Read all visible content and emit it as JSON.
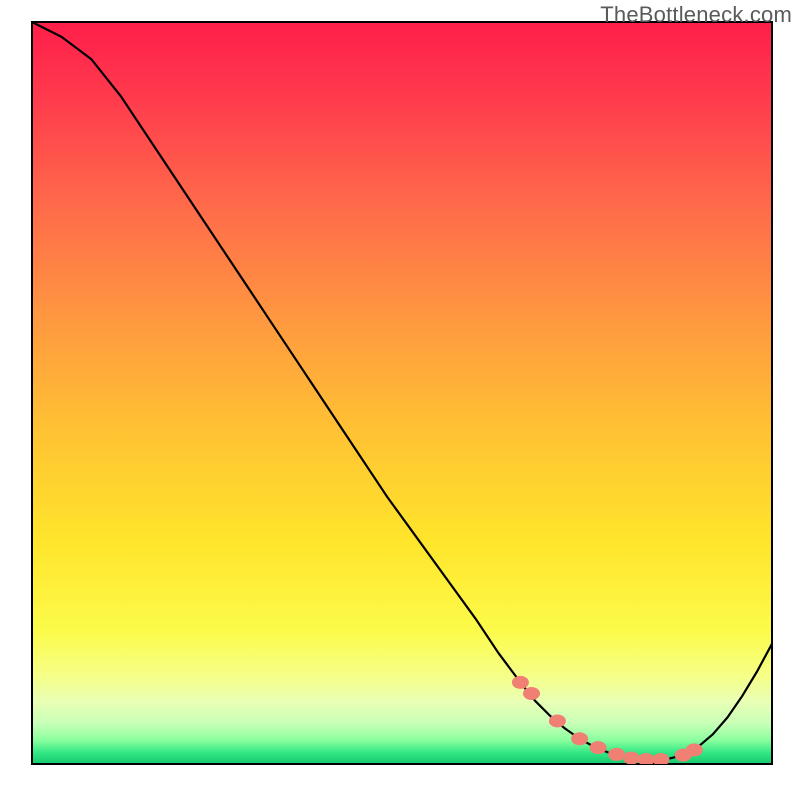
{
  "watermark": "TheBottleneck.com",
  "colors": {
    "curve": "#000000",
    "marker": "#f08074",
    "border": "#000000"
  },
  "chart_data": {
    "type": "line",
    "title": "",
    "xlabel": "",
    "ylabel": "",
    "grid": false,
    "legend": false,
    "xlim": [
      0,
      100
    ],
    "ylim": [
      0,
      100
    ],
    "series": [
      {
        "name": "bottleneck-curve",
        "x": [
          0,
          4,
          8,
          12,
          16,
          20,
          24,
          28,
          32,
          36,
          40,
          44,
          48,
          52,
          56,
          60,
          63,
          66,
          68,
          70,
          72,
          74,
          76,
          78,
          80,
          82,
          84,
          86,
          88,
          90,
          92,
          94,
          96,
          98,
          100
        ],
        "y": [
          100,
          98,
          95,
          90,
          84,
          78,
          72,
          66,
          60,
          54,
          48,
          42,
          36,
          30.5,
          25,
          19.5,
          15,
          11,
          8.5,
          6.5,
          4.8,
          3.4,
          2.3,
          1.5,
          1.0,
          0.7,
          0.6,
          0.7,
          1.2,
          2.3,
          4.0,
          6.3,
          9.2,
          12.5,
          16.2
        ]
      }
    ],
    "markers": {
      "name": "highlighted-points",
      "x": [
        66,
        67.5,
        71,
        74,
        76.5,
        79,
        81,
        83,
        85,
        88,
        89.5
      ],
      "y": [
        11,
        9.5,
        5.8,
        3.4,
        2.2,
        1.3,
        0.8,
        0.6,
        0.6,
        1.2,
        1.9
      ]
    }
  }
}
